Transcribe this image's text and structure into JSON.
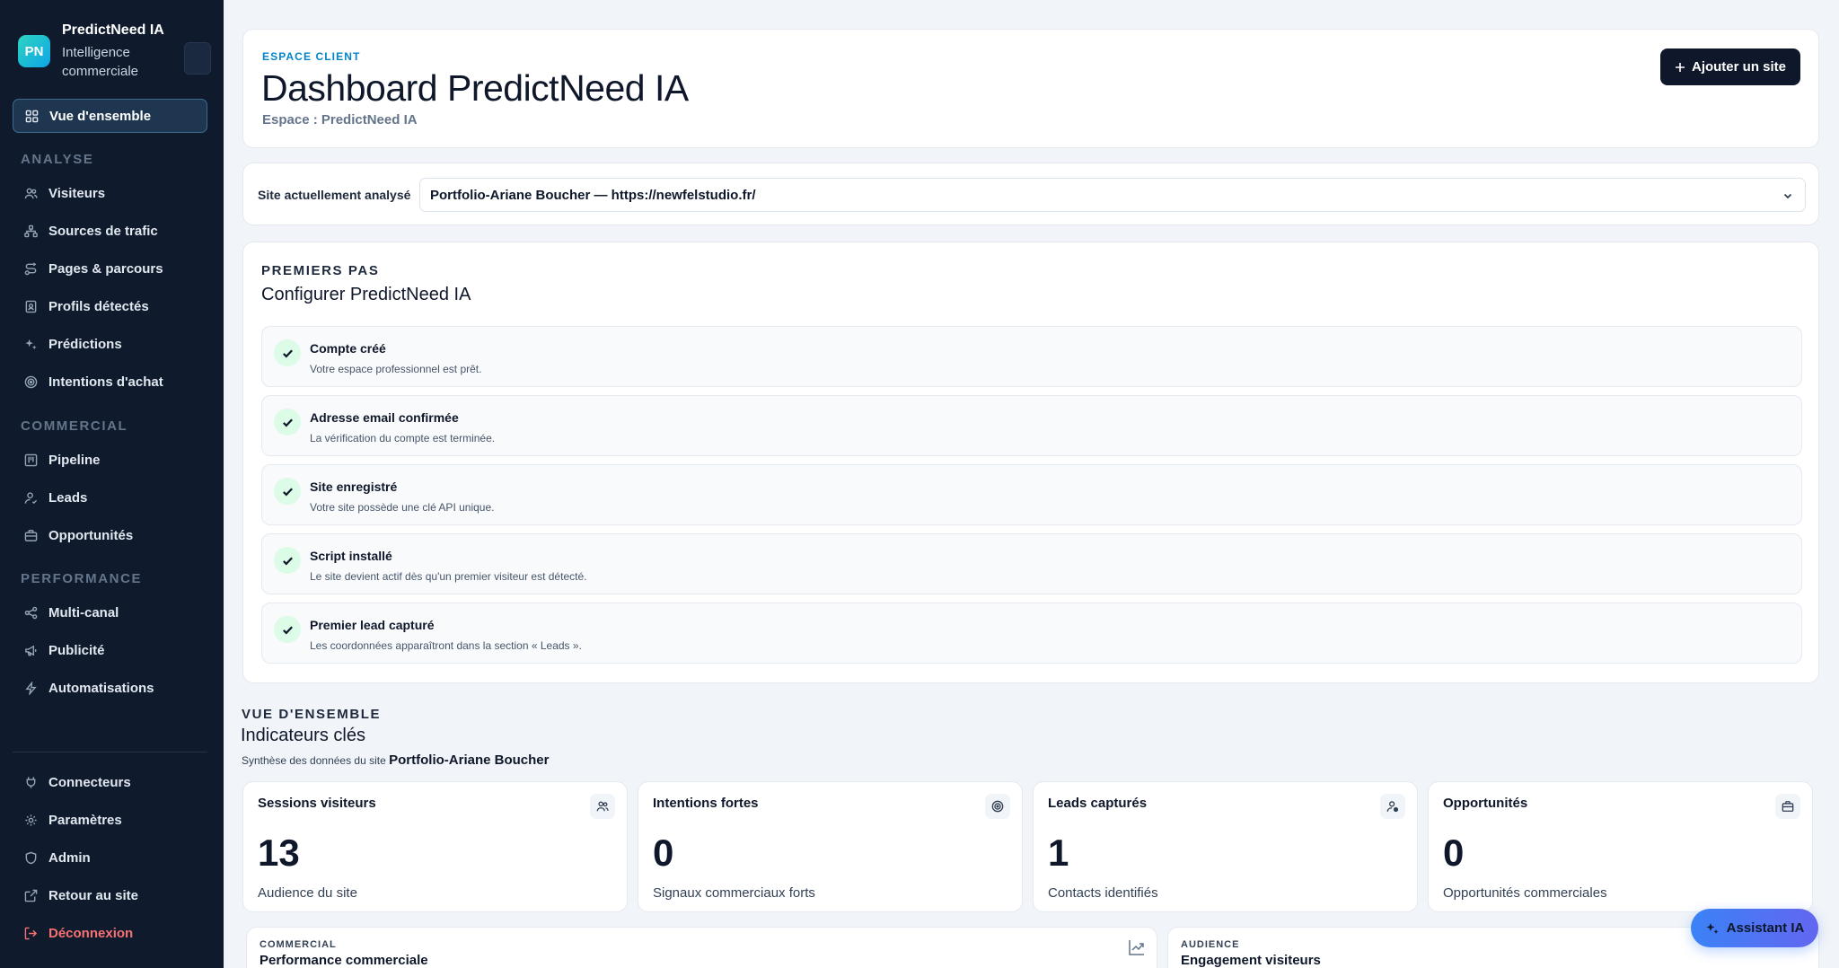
{
  "brand": {
    "logo_text": "PN",
    "name": "PredictNeed IA",
    "subtitle": "Intelligence commerciale"
  },
  "sidebar": {
    "overview": {
      "label": "Vue d'ensemble",
      "icon": "grid-icon"
    },
    "sections": {
      "analyse": "ANALYSE",
      "commercial": "COMMERCIAL",
      "performance": "PERFORMANCE"
    },
    "analyse_items": [
      {
        "label": "Visiteurs",
        "icon": "users-icon"
      },
      {
        "label": "Sources de trafic",
        "icon": "sitemap-icon"
      },
      {
        "label": "Pages & parcours",
        "icon": "route-icon"
      },
      {
        "label": "Profils détectés",
        "icon": "id-badge-icon"
      },
      {
        "label": "Prédictions",
        "icon": "sparkles-icon"
      },
      {
        "label": "Intentions d'achat",
        "icon": "target-icon"
      }
    ],
    "commercial_items": [
      {
        "label": "Pipeline",
        "icon": "kanban-icon"
      },
      {
        "label": "Leads",
        "icon": "user-check-icon"
      },
      {
        "label": "Opportunités",
        "icon": "briefcase-icon"
      }
    ],
    "performance_items": [
      {
        "label": "Multi-canal",
        "icon": "share-icon"
      },
      {
        "label": "Publicité",
        "icon": "megaphone-icon"
      },
      {
        "label": "Automatisations",
        "icon": "bolt-icon"
      }
    ],
    "footer_items": [
      {
        "label": "Connecteurs",
        "icon": "plug-icon"
      },
      {
        "label": "Paramètres",
        "icon": "gear-icon"
      },
      {
        "label": "Admin",
        "icon": "shield-icon"
      },
      {
        "label": "Retour au site",
        "icon": "external-link-icon"
      },
      {
        "label": "Déconnexion",
        "icon": "logout-icon"
      }
    ]
  },
  "header": {
    "eyebrow": "ESPACE CLIENT",
    "title": "Dashboard PredictNeed IA",
    "subtitle": "Espace : PredictNeed IA",
    "add_button": "Ajouter un site"
  },
  "site_selector": {
    "label": "Site actuellement analysé",
    "selected": "Portfolio-Ariane Boucher — https://newfelstudio.fr/"
  },
  "getting_started": {
    "eyebrow": "PREMIERS PAS",
    "title": "Configurer PredictNeed IA",
    "steps": [
      {
        "title": "Compte créé",
        "desc": "Votre espace professionnel est prêt."
      },
      {
        "title": "Adresse email confirmée",
        "desc": "La vérification du compte est terminée."
      },
      {
        "title": "Site enregistré",
        "desc": "Votre site possède une clé API unique."
      },
      {
        "title": "Script installé",
        "desc": "Le site devient actif dès qu'un premier visiteur est détecté."
      },
      {
        "title": "Premier lead capturé",
        "desc": "Les coordonnées apparaîtront dans la section « Leads »."
      }
    ]
  },
  "overview": {
    "eyebrow": "VUE D'ENSEMBLE",
    "title": "Indicateurs clés",
    "subtitle_prefix": "Synthèse des données du site",
    "site_name": "Portfolio-Ariane Boucher"
  },
  "kpis": [
    {
      "title": "Sessions visiteurs",
      "value": "13",
      "desc": "Audience du site",
      "icon": "users-icon"
    },
    {
      "title": "Intentions fortes",
      "value": "0",
      "desc": "Signaux commerciaux forts",
      "icon": "target-icon"
    },
    {
      "title": "Leads capturés",
      "value": "1",
      "desc": "Contacts identifiés",
      "icon": "user-check-icon"
    },
    {
      "title": "Opportunités",
      "value": "0",
      "desc": "Opportunités commerciales",
      "icon": "briefcase-icon"
    }
  ],
  "bottom_cards": [
    {
      "eyebrow": "COMMERCIAL",
      "title": "Performance commerciale",
      "icon": "trend-chart-icon"
    },
    {
      "eyebrow": "AUDIENCE",
      "title": "Engagement visiteurs",
      "icon": "chevron-icon"
    }
  ],
  "assistant": {
    "label": "Assistant IA",
    "icon": "sparkles-icon"
  },
  "colors": {
    "sidebar_bg": "#0f1b2d",
    "accent_blue": "#0284c7",
    "logout_red": "#f87171",
    "check_bg": "#dcfce7"
  }
}
